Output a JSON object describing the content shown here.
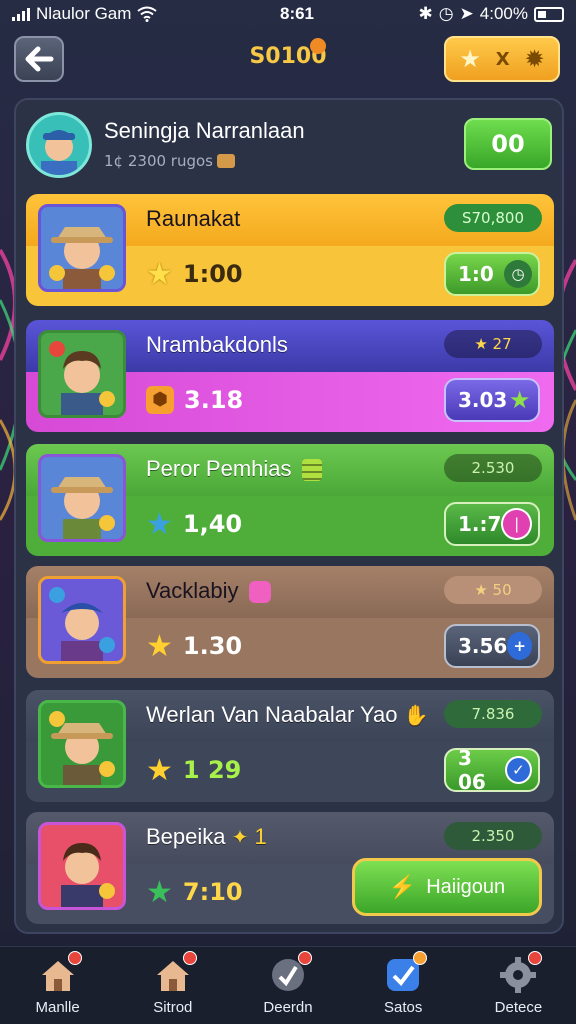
{
  "status_bar": {
    "carrier": "Nlaulor Gam",
    "time": "8:61",
    "battery": "4:00%"
  },
  "header": {
    "title": "S0100",
    "settings_label": "X"
  },
  "user": {
    "name": "Seningja Narranlaan",
    "subtitle": "1¢ 2300 rugos",
    "button_label": "00"
  },
  "cards": [
    {
      "name": "Raunakat",
      "tag": "S70,800",
      "stat": "1:00",
      "value": "1:0",
      "stat_icon": "star-icon",
      "value_icon": "clock-icon"
    },
    {
      "name": "Nrambakdonls",
      "tag": "★ 27",
      "stat": "3.18",
      "value": "3.03",
      "stat_icon": "shield-icon",
      "value_icon": "star-icon"
    },
    {
      "name": "Peror Pemhias",
      "tag": "2.530",
      "stat": "1,40",
      "value": "1.:7",
      "stat_icon": "star-icon",
      "value_icon": "power-icon"
    },
    {
      "name": "Vacklabiy",
      "tag": "★ 50",
      "stat": "1.30",
      "value": "3.56",
      "stat_icon": "star-icon",
      "value_icon": "plus-icon"
    },
    {
      "name": "Werlan Van Naabalar Yao",
      "tag": "7.836",
      "stat": "1 29",
      "value": "3 06",
      "stat_icon": "star-icon",
      "value_icon": "check-icon"
    },
    {
      "name": "Bepeika",
      "name_suffix": "1",
      "tag": "2.350",
      "stat": "7:10",
      "action_label": "Haiigoun",
      "stat_icon": "star-icon"
    }
  ],
  "nav": [
    {
      "label": "Manlle",
      "icon": "home-icon"
    },
    {
      "label": "Sitrod",
      "icon": "home-icon"
    },
    {
      "label": "Deerdn",
      "icon": "tag-icon"
    },
    {
      "label": "Satos",
      "icon": "check-icon"
    },
    {
      "label": "Detece",
      "icon": "gear-icon"
    }
  ],
  "colors": {
    "accent_gold": "#f7c845",
    "green": "#4cc23a",
    "purple": "#e05ae0",
    "brown": "#9a7a64"
  }
}
